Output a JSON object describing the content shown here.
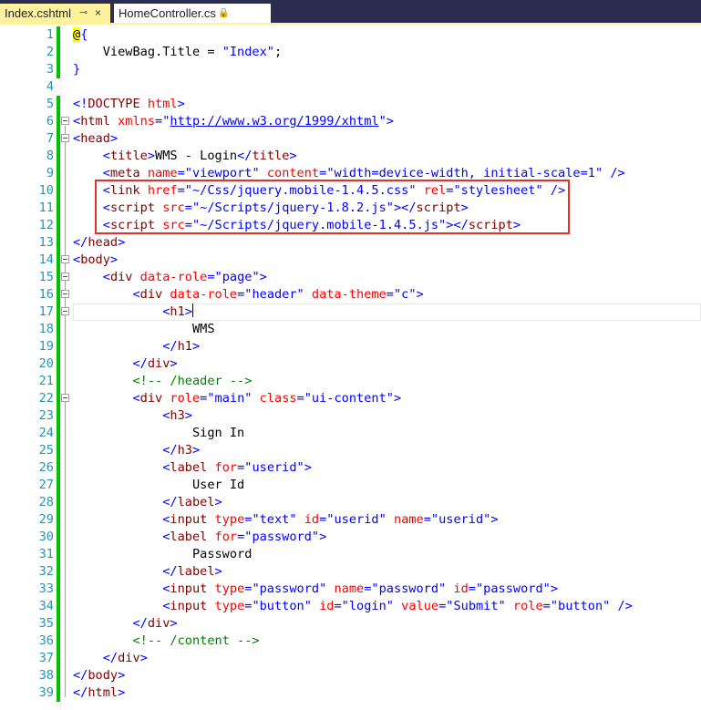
{
  "tabs": [
    {
      "label": "Index.cshtml",
      "active": true,
      "pin_icon": "pin-icon",
      "close_icon": "close-icon"
    },
    {
      "label": "HomeController.cs",
      "active": false,
      "lock_icon": "lock-icon"
    }
  ],
  "colors": {
    "tabbar_bg": "#2d2d52",
    "active_tab": "#fff29d",
    "line_number": "#2b91af",
    "change_bar": "#00c000",
    "highlight_box": "#e03030"
  },
  "editor": {
    "current_line": 17,
    "highlighted_lines": [
      10,
      11,
      12
    ],
    "lines": [
      {
        "n": "1",
        "tokens": [
          [
            "razor",
            "@"
          ],
          [
            "delim",
            "{"
          ]
        ]
      },
      {
        "n": "2",
        "tokens": [
          [
            "txt",
            "    ViewBag.Title = "
          ],
          [
            "str",
            "\"Index\""
          ],
          [
            "txt",
            ";"
          ]
        ]
      },
      {
        "n": "3",
        "tokens": [
          [
            "delim",
            "}"
          ]
        ]
      },
      {
        "n": "4",
        "tokens": []
      },
      {
        "n": "5",
        "tokens": [
          [
            "delim",
            "<!"
          ],
          [
            "tag",
            "DOCTYPE"
          ],
          [
            "attr",
            " html"
          ],
          [
            "delim",
            ">"
          ]
        ]
      },
      {
        "n": "6",
        "tokens": [
          [
            "delim",
            "<"
          ],
          [
            "tag",
            "html"
          ],
          [
            "attr",
            " xmlns"
          ],
          [
            "delim",
            "=\""
          ],
          [
            "url",
            "http://www.w3.org/1999/xhtml"
          ],
          [
            "delim",
            "\">"
          ]
        ]
      },
      {
        "n": "7",
        "tokens": [
          [
            "delim",
            "<"
          ],
          [
            "tag",
            "head"
          ],
          [
            "delim",
            ">"
          ]
        ]
      },
      {
        "n": "8",
        "tokens": [
          [
            "txt",
            "    "
          ],
          [
            "delim",
            "<"
          ],
          [
            "tag",
            "title"
          ],
          [
            "delim",
            ">"
          ],
          [
            "txt",
            "WMS - Login"
          ],
          [
            "delim",
            "</"
          ],
          [
            "tag",
            "title"
          ],
          [
            "delim",
            ">"
          ]
        ]
      },
      {
        "n": "9",
        "tokens": [
          [
            "txt",
            "    "
          ],
          [
            "delim",
            "<"
          ],
          [
            "tag",
            "meta"
          ],
          [
            "attr",
            " name"
          ],
          [
            "delim",
            "="
          ],
          [
            "str",
            "\"viewport\""
          ],
          [
            "attr",
            " content"
          ],
          [
            "delim",
            "="
          ],
          [
            "str",
            "\"width=device-width, initial-scale=1\""
          ],
          [
            "delim",
            " />"
          ]
        ]
      },
      {
        "n": "10",
        "tokens": [
          [
            "txt",
            "    "
          ],
          [
            "delim",
            "<"
          ],
          [
            "tag",
            "link"
          ],
          [
            "attr",
            " href"
          ],
          [
            "delim",
            "="
          ],
          [
            "str",
            "\"~/Css/jquery.mobile-1.4.5.css\""
          ],
          [
            "attr",
            " rel"
          ],
          [
            "delim",
            "="
          ],
          [
            "str",
            "\"stylesheet\""
          ],
          [
            "delim",
            " />"
          ]
        ]
      },
      {
        "n": "11",
        "tokens": [
          [
            "txt",
            "    "
          ],
          [
            "delim",
            "<"
          ],
          [
            "tag",
            "script"
          ],
          [
            "attr",
            " src"
          ],
          [
            "delim",
            "="
          ],
          [
            "str",
            "\"~/Scripts/jquery-1.8.2.js\""
          ],
          [
            "delim",
            "></"
          ],
          [
            "tag",
            "script"
          ],
          [
            "delim",
            ">"
          ]
        ]
      },
      {
        "n": "12",
        "tokens": [
          [
            "txt",
            "    "
          ],
          [
            "delim",
            "<"
          ],
          [
            "tag",
            "script"
          ],
          [
            "attr",
            " src"
          ],
          [
            "delim",
            "="
          ],
          [
            "str",
            "\"~/Scripts/jquery.mobile-1.4.5.js\""
          ],
          [
            "delim",
            "></"
          ],
          [
            "tag",
            "script"
          ],
          [
            "delim",
            ">"
          ]
        ]
      },
      {
        "n": "13",
        "tokens": [
          [
            "delim",
            "</"
          ],
          [
            "tag",
            "head"
          ],
          [
            "delim",
            ">"
          ]
        ]
      },
      {
        "n": "14",
        "tokens": [
          [
            "delim",
            "<"
          ],
          [
            "tag",
            "body"
          ],
          [
            "delim",
            ">"
          ]
        ]
      },
      {
        "n": "15",
        "tokens": [
          [
            "txt",
            "    "
          ],
          [
            "delim",
            "<"
          ],
          [
            "tag",
            "div"
          ],
          [
            "attr",
            " data-role"
          ],
          [
            "delim",
            "="
          ],
          [
            "str",
            "\"page\""
          ],
          [
            "delim",
            ">"
          ]
        ]
      },
      {
        "n": "16",
        "tokens": [
          [
            "txt",
            "        "
          ],
          [
            "delim",
            "<"
          ],
          [
            "tag",
            "div"
          ],
          [
            "attr",
            " data-role"
          ],
          [
            "delim",
            "="
          ],
          [
            "str",
            "\"header\""
          ],
          [
            "attr",
            " data-theme"
          ],
          [
            "delim",
            "="
          ],
          [
            "str",
            "\"c\""
          ],
          [
            "delim",
            ">"
          ]
        ]
      },
      {
        "n": "17",
        "tokens": [
          [
            "txt",
            "            "
          ],
          [
            "delim",
            "<"
          ],
          [
            "tag",
            "h1"
          ],
          [
            "delim",
            ">"
          ],
          [
            "caret",
            ""
          ]
        ]
      },
      {
        "n": "18",
        "tokens": [
          [
            "txt",
            "                WMS"
          ]
        ]
      },
      {
        "n": "19",
        "tokens": [
          [
            "txt",
            "            "
          ],
          [
            "delim",
            "</"
          ],
          [
            "tag",
            "h1"
          ],
          [
            "delim",
            ">"
          ]
        ]
      },
      {
        "n": "20",
        "tokens": [
          [
            "txt",
            "        "
          ],
          [
            "delim",
            "</"
          ],
          [
            "tag",
            "div"
          ],
          [
            "delim",
            ">"
          ]
        ]
      },
      {
        "n": "21",
        "tokens": [
          [
            "txt",
            "        "
          ],
          [
            "cmt",
            "<!-- /header -->"
          ]
        ]
      },
      {
        "n": "22",
        "tokens": [
          [
            "txt",
            "        "
          ],
          [
            "delim",
            "<"
          ],
          [
            "tag",
            "div"
          ],
          [
            "attr",
            " role"
          ],
          [
            "delim",
            "="
          ],
          [
            "str",
            "\"main\""
          ],
          [
            "attr",
            " class"
          ],
          [
            "delim",
            "="
          ],
          [
            "str",
            "\"ui-content\""
          ],
          [
            "delim",
            ">"
          ]
        ]
      },
      {
        "n": "23",
        "tokens": [
          [
            "txt",
            "            "
          ],
          [
            "delim",
            "<"
          ],
          [
            "tag",
            "h3"
          ],
          [
            "delim",
            ">"
          ]
        ]
      },
      {
        "n": "24",
        "tokens": [
          [
            "txt",
            "                Sign In"
          ]
        ]
      },
      {
        "n": "25",
        "tokens": [
          [
            "txt",
            "            "
          ],
          [
            "delim",
            "</"
          ],
          [
            "tag",
            "h3"
          ],
          [
            "delim",
            ">"
          ]
        ]
      },
      {
        "n": "26",
        "tokens": [
          [
            "txt",
            "            "
          ],
          [
            "delim",
            "<"
          ],
          [
            "tag",
            "label"
          ],
          [
            "attr",
            " for"
          ],
          [
            "delim",
            "="
          ],
          [
            "str",
            "\"userid\""
          ],
          [
            "delim",
            ">"
          ]
        ]
      },
      {
        "n": "27",
        "tokens": [
          [
            "txt",
            "                User Id"
          ]
        ]
      },
      {
        "n": "28",
        "tokens": [
          [
            "txt",
            "            "
          ],
          [
            "delim",
            "</"
          ],
          [
            "tag",
            "label"
          ],
          [
            "delim",
            ">"
          ]
        ]
      },
      {
        "n": "29",
        "tokens": [
          [
            "txt",
            "            "
          ],
          [
            "delim",
            "<"
          ],
          [
            "tag",
            "input"
          ],
          [
            "attr",
            " type"
          ],
          [
            "delim",
            "="
          ],
          [
            "str",
            "\"text\""
          ],
          [
            "attr",
            " id"
          ],
          [
            "delim",
            "="
          ],
          [
            "str",
            "\"userid\""
          ],
          [
            "attr",
            " name"
          ],
          [
            "delim",
            "="
          ],
          [
            "str",
            "\"userid\""
          ],
          [
            "delim",
            ">"
          ]
        ]
      },
      {
        "n": "30",
        "tokens": [
          [
            "txt",
            "            "
          ],
          [
            "delim",
            "<"
          ],
          [
            "tag",
            "label"
          ],
          [
            "attr",
            " for"
          ],
          [
            "delim",
            "="
          ],
          [
            "str",
            "\"password\""
          ],
          [
            "delim",
            ">"
          ]
        ]
      },
      {
        "n": "31",
        "tokens": [
          [
            "txt",
            "                Password"
          ]
        ]
      },
      {
        "n": "32",
        "tokens": [
          [
            "txt",
            "            "
          ],
          [
            "delim",
            "</"
          ],
          [
            "tag",
            "label"
          ],
          [
            "delim",
            ">"
          ]
        ]
      },
      {
        "n": "33",
        "tokens": [
          [
            "txt",
            "            "
          ],
          [
            "delim",
            "<"
          ],
          [
            "tag",
            "input"
          ],
          [
            "attr",
            " type"
          ],
          [
            "delim",
            "="
          ],
          [
            "str",
            "\"password\""
          ],
          [
            "attr",
            " name"
          ],
          [
            "delim",
            "="
          ],
          [
            "str",
            "\"password\""
          ],
          [
            "attr",
            " id"
          ],
          [
            "delim",
            "="
          ],
          [
            "str",
            "\"password\""
          ],
          [
            "delim",
            ">"
          ]
        ]
      },
      {
        "n": "34",
        "tokens": [
          [
            "txt",
            "            "
          ],
          [
            "delim",
            "<"
          ],
          [
            "tag",
            "input"
          ],
          [
            "attr",
            " type"
          ],
          [
            "delim",
            "="
          ],
          [
            "str",
            "\"button\""
          ],
          [
            "attr",
            " id"
          ],
          [
            "delim",
            "="
          ],
          [
            "str",
            "\"login\""
          ],
          [
            "attr",
            " value"
          ],
          [
            "delim",
            "="
          ],
          [
            "str",
            "\"Submit\""
          ],
          [
            "attr",
            " role"
          ],
          [
            "delim",
            "="
          ],
          [
            "str",
            "\"button\""
          ],
          [
            "delim",
            " />"
          ]
        ]
      },
      {
        "n": "35",
        "tokens": [
          [
            "txt",
            "        "
          ],
          [
            "delim",
            "</"
          ],
          [
            "tag",
            "div"
          ],
          [
            "delim",
            ">"
          ]
        ]
      },
      {
        "n": "36",
        "tokens": [
          [
            "txt",
            "        "
          ],
          [
            "cmt",
            "<!-- /content -->"
          ]
        ]
      },
      {
        "n": "37",
        "tokens": [
          [
            "txt",
            "    "
          ],
          [
            "delim",
            "</"
          ],
          [
            "tag",
            "div"
          ],
          [
            "delim",
            ">"
          ]
        ]
      },
      {
        "n": "38",
        "tokens": [
          [
            "delim",
            "</"
          ],
          [
            "tag",
            "body"
          ],
          [
            "delim",
            ">"
          ]
        ]
      },
      {
        "n": "39",
        "tokens": [
          [
            "delim",
            "</"
          ],
          [
            "tag",
            "html"
          ],
          [
            "delim",
            ">"
          ]
        ]
      }
    ]
  }
}
